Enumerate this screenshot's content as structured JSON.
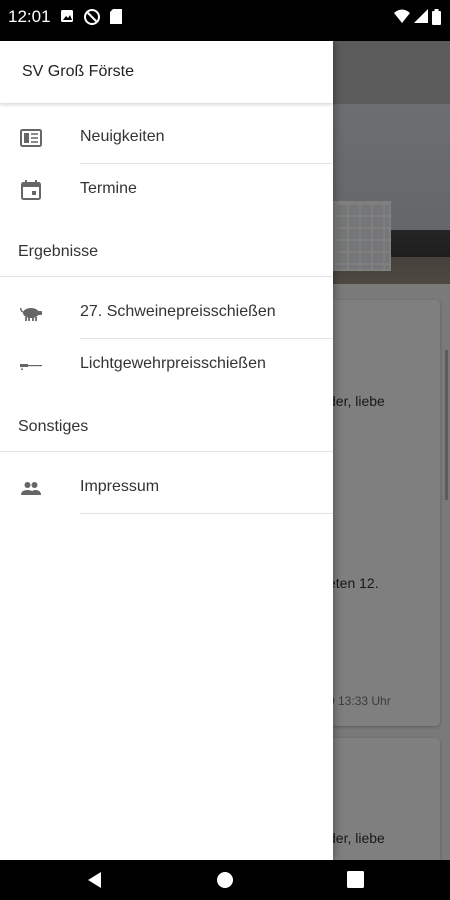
{
  "status_bar": {
    "time": "12:01"
  },
  "drawer": {
    "title": "SV Groß Förste",
    "items": [
      {
        "label": "Neuigkeiten",
        "icon": "newspaper-icon"
      },
      {
        "label": "Termine",
        "icon": "calendar-icon"
      }
    ],
    "sections": [
      {
        "title": "Ergebnisse",
        "items": [
          {
            "label": "27. Schweinepreisschießen",
            "icon": "pig-icon"
          },
          {
            "label": "Lichtgewehrpreisschießen",
            "icon": "rifle-icon"
          }
        ]
      },
      {
        "title": "Sonstiges",
        "items": [
          {
            "label": "Impressum",
            "icon": "people-icon"
          }
        ]
      }
    ]
  },
  "background": {
    "card1_text_a": "der, liebe",
    "card1_text_b": "eten 12.",
    "card1_meta": "0 13:33 Uhr",
    "card2_text_a": "der, liebe"
  }
}
